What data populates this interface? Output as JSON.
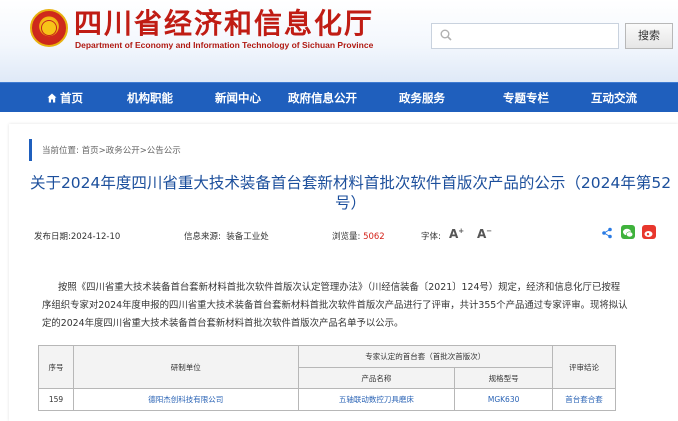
{
  "header": {
    "site_title": "四川省经济和信息化厅",
    "site_subtitle": "Department of Economy and Information Technology of Sichuan Province",
    "search_placeholder": "",
    "search_button": "搜索"
  },
  "nav": {
    "items": [
      "首页",
      "机构职能",
      "新闻中心",
      "政府信息公开",
      "政务服务",
      "专题专栏",
      "互动交流"
    ]
  },
  "breadcrumb": "当前位置: 首页>政务公开>公告公示",
  "article": {
    "title_line1": "关于2024年度四川省重大技术装备首台套新材料首批次软件首版次产品的公示（2024年第52",
    "title_line2": "号）",
    "date_label": "发布日期:",
    "date": "2024-12-10",
    "source_label": "信息来源:",
    "source": "装备工业处",
    "views_label": "浏览量:",
    "views": "5062",
    "font_label": "字体:",
    "font_increase": "A",
    "font_decrease": "A",
    "body_line1": "按照《四川省重大技术装备首台套新材料首批次软件首版次认定管理办法》（川经信装备〔2021〕124号）规定，经济和信息化厅已按程",
    "body_line2": "序组织专家对2024年度申报的四川省重大技术装备首台套新材料首批次软件首版次产品进行了评审，共计355个产品通过专家评审。现将拟认",
    "body_line3": "定的2024年度四川省重大技术装备首台套新材料首批次软件首版次产品名单予以公示。"
  },
  "table": {
    "col_index": "序号",
    "col_unit": "研制单位",
    "col_group": "专家认定的首台套（首批次首版次）",
    "col_product": "产品名称",
    "col_model": "规格型号",
    "col_conclusion": "评审结论",
    "rows": [
      {
        "index": "159",
        "unit": "德阳杰创科技有限公司",
        "product": "五轴联动数控刀具磨床",
        "model": "MGK630",
        "conclusion": "首台套合套"
      }
    ]
  },
  "colors": {
    "brand_red": "#c01c14",
    "nav_blue": "#1f5fbd",
    "title_blue": "#1c4f9c",
    "views_red": "#d4231a"
  },
  "icons": [
    "emblem-icon",
    "search-icon",
    "home-icon",
    "share-icon",
    "wechat-icon",
    "weibo-icon"
  ]
}
